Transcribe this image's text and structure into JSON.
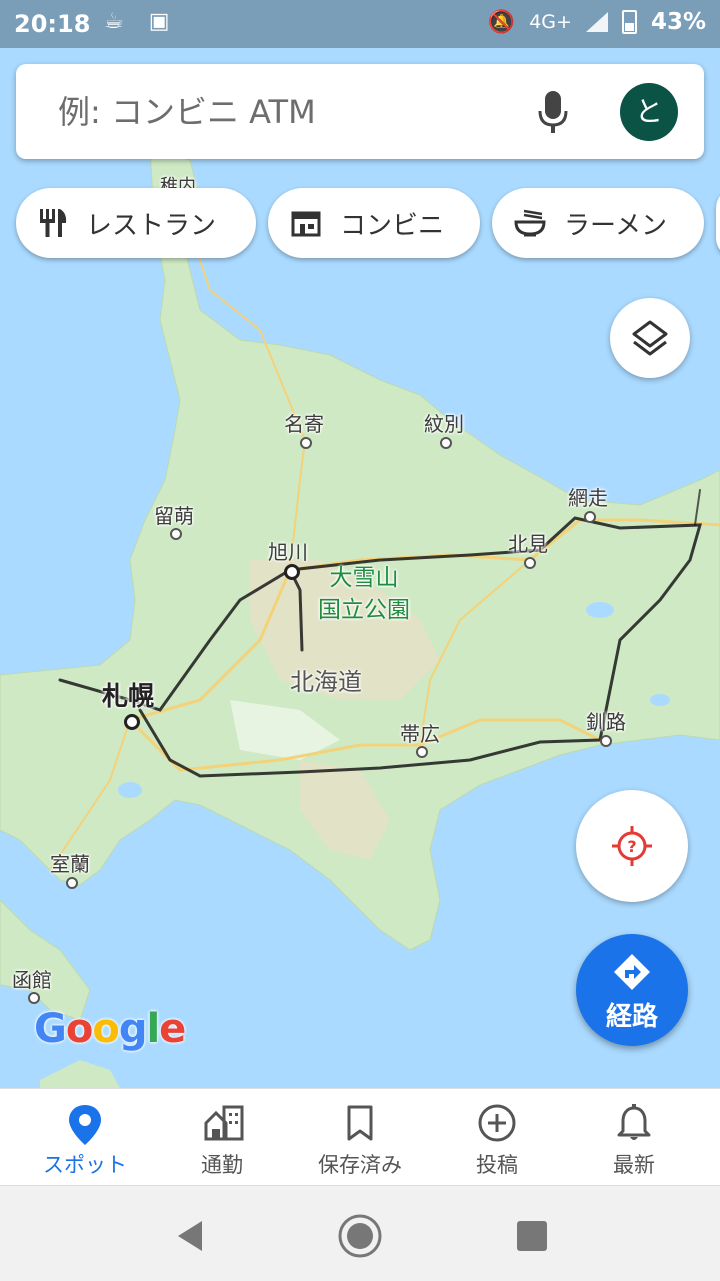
{
  "status_bar": {
    "time": "20:18",
    "network": "4G+",
    "battery": "43%"
  },
  "search": {
    "placeholder": "例: コンビニ ATM",
    "avatar_letter": "と"
  },
  "chips": [
    {
      "label": "レストラン",
      "icon": "fork-knife-icon"
    },
    {
      "label": "コンビニ",
      "icon": "store-icon"
    },
    {
      "label": "ラーメン",
      "icon": "ramen-bowl-icon"
    }
  ],
  "map": {
    "places": {
      "wakkanai": "稚内",
      "nayoro": "名寄",
      "monbetsu": "紋別",
      "rumoi": "留萌",
      "abashiri": "網走",
      "asahikawa": "旭川",
      "kitami": "北見",
      "daisetsuzan": [
        "大雪山",
        "国立公園"
      ],
      "hokkaido": "北海道",
      "sapporo": "札幌",
      "obihiro": "帯広",
      "kushiro": "釧路",
      "muroran": "室蘭",
      "hakodate": "函館"
    },
    "colors": {
      "water": "#aadaff",
      "land": "#cfe9c4",
      "route_scribble": "#1a1a1a"
    },
    "attribution": "Google"
  },
  "buttons": {
    "route_label": "経路"
  },
  "bottom_nav": [
    {
      "label": "スポット",
      "icon": "pin-icon",
      "active": true
    },
    {
      "label": "通勤",
      "icon": "commute-icon",
      "active": false
    },
    {
      "label": "保存済み",
      "icon": "bookmark-icon",
      "active": false
    },
    {
      "label": "投稿",
      "icon": "add-circle-icon",
      "active": false
    },
    {
      "label": "最新",
      "icon": "bell-icon",
      "active": false
    }
  ],
  "colors": {
    "accent": "#1a73e8",
    "avatar_bg": "#0b5345",
    "locate_icon": "#e53935"
  }
}
